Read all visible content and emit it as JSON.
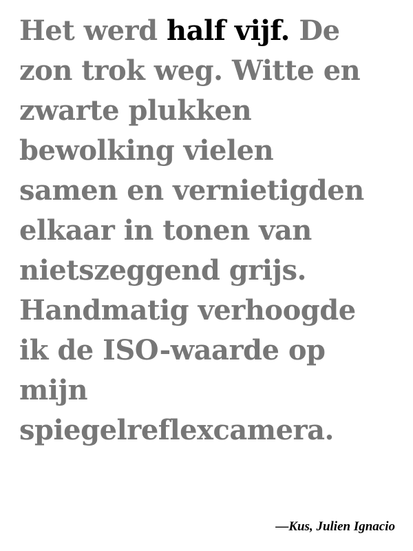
{
  "quote": {
    "first_line": {
      "before": "Het werd ",
      "highlight": "half vijf.",
      "after": " De"
    },
    "lines": [
      "zon trok weg. Witte en",
      "zwarte plukken",
      "bewolking vielen",
      "samen en vernietigden",
      "elkaar in tonen van",
      "nietszeggend grijs.",
      "Handmatig verhoogde",
      "ik de ISO-waarde op",
      "mijn",
      "spiegelreflexcamera."
    ]
  },
  "attribution": "—Kus, Julien Ignacio"
}
